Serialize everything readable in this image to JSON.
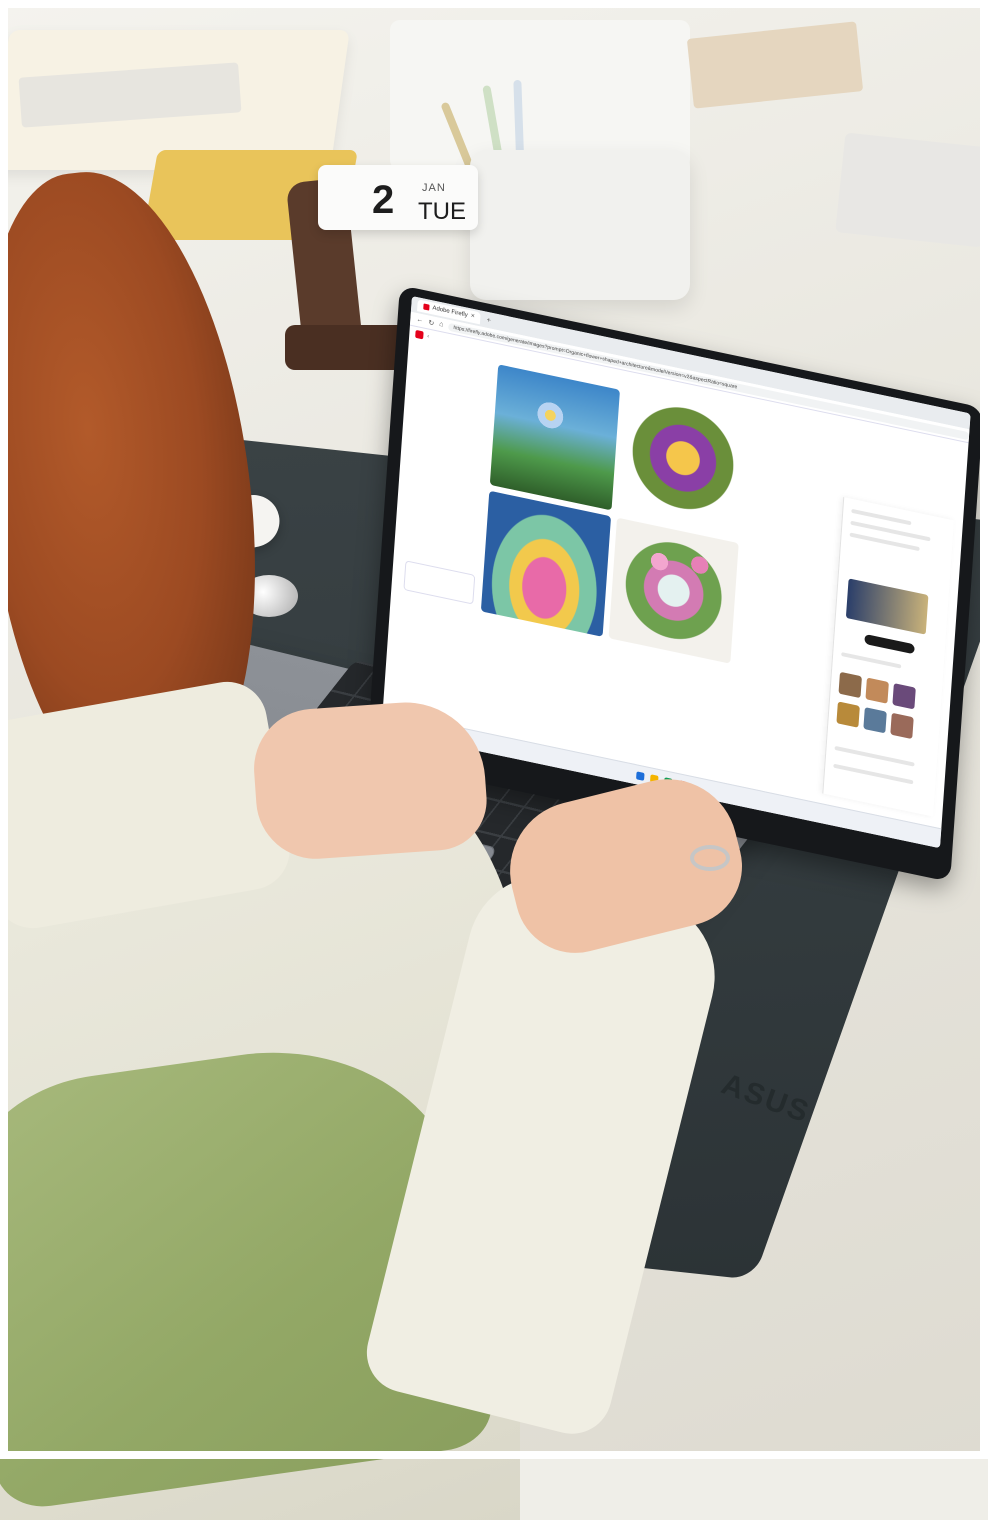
{
  "calendar": {
    "day": "2",
    "month": "JAN",
    "weekday": "TUE"
  },
  "desk_mat": {
    "brand": "ASUS"
  },
  "browser": {
    "tab_title": "Adobe Firefly",
    "url": "https://firefly.adobe.com/generate/images?prompt=Organic+flower+shaped+architecture&modelVersion=v2&aspectRatio=square"
  },
  "colors": {
    "sweater": "#ecebdf",
    "sleeve_accent": "#a7b97c",
    "mat": "#343c3f",
    "laptop": "#858990"
  }
}
